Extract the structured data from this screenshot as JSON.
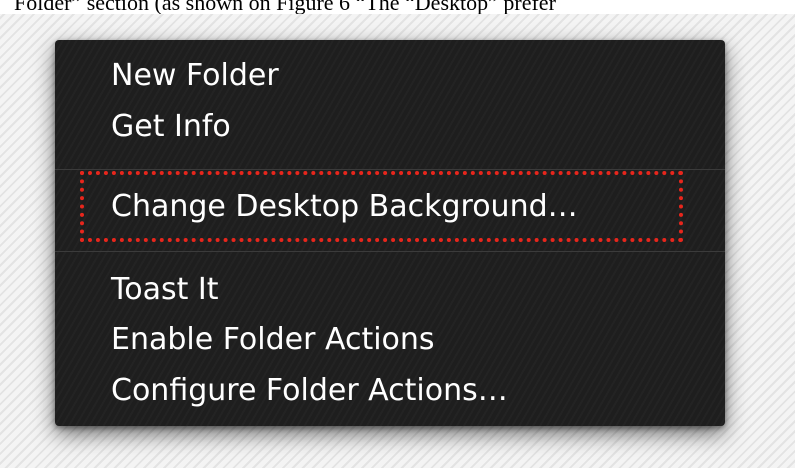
{
  "caption": {
    "text": "Folder” section (as shown on Figure 6 “The “Desktop” prefer"
  },
  "context_menu": {
    "items": [
      {
        "label": "New Folder"
      },
      {
        "label": "Get Info"
      },
      {
        "label": "Change Desktop Background…"
      },
      {
        "label": "Toast It"
      },
      {
        "label": "Enable Folder Actions"
      },
      {
        "label": "Configure Folder Actions…"
      }
    ]
  },
  "annotation": {
    "highlight_color": "#e8261c",
    "highlighted_item": "Change Desktop Background…"
  },
  "colors": {
    "menu_background": "#1e1e1e",
    "menu_text": "#ffffff",
    "separator": "#3b3b3b"
  }
}
